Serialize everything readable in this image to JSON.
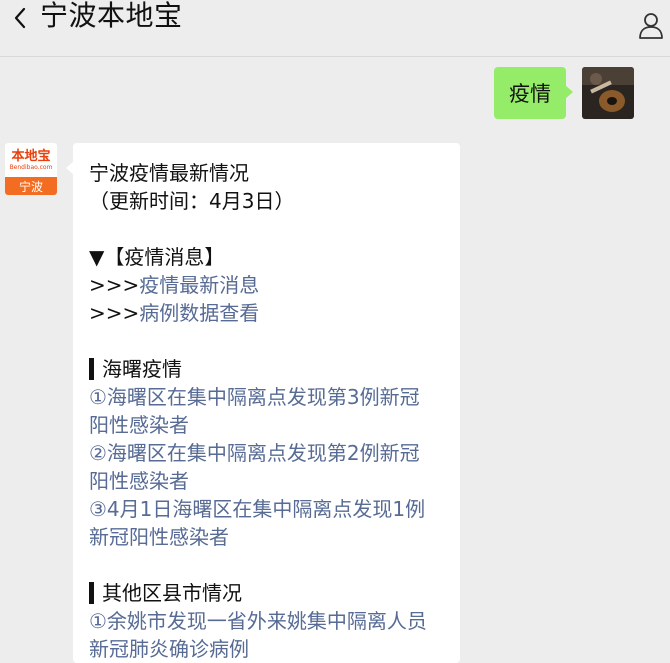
{
  "header": {
    "title": "宁波本地宝"
  },
  "chat": {
    "outgoing": {
      "text": "疫情"
    },
    "bot": {
      "logo_main": "本地宝",
      "logo_sub": "Bendibao.com",
      "logo_city": "宁波"
    },
    "reply": {
      "title": "宁波疫情最新情况",
      "updated": "（更新时间：4月3日）",
      "news_header": "▼【疫情消息】",
      "prefix": ">>>",
      "links": [
        "疫情最新消息",
        "病例数据查看"
      ],
      "section1_title": "海曙疫情",
      "section1_items": [
        [
          "①海曙区在集中隔离点发现第3例新冠",
          "阳性感染者"
        ],
        [
          "②海曙区在集中隔离点发现第2例新冠",
          "阳性感染者"
        ],
        [
          "③4月1日海曙区在集中隔离点发现1例",
          "新冠阳性感染者"
        ]
      ],
      "section2_title": "其他区县市情况",
      "section2_items": [
        [
          "①余姚市发现一省外来姚集中隔离人员",
          "新冠肺炎确诊病例"
        ]
      ]
    }
  },
  "colors": {
    "outgoing_bubble": "#95ec69",
    "link": "#576b95",
    "background": "#ededed"
  }
}
